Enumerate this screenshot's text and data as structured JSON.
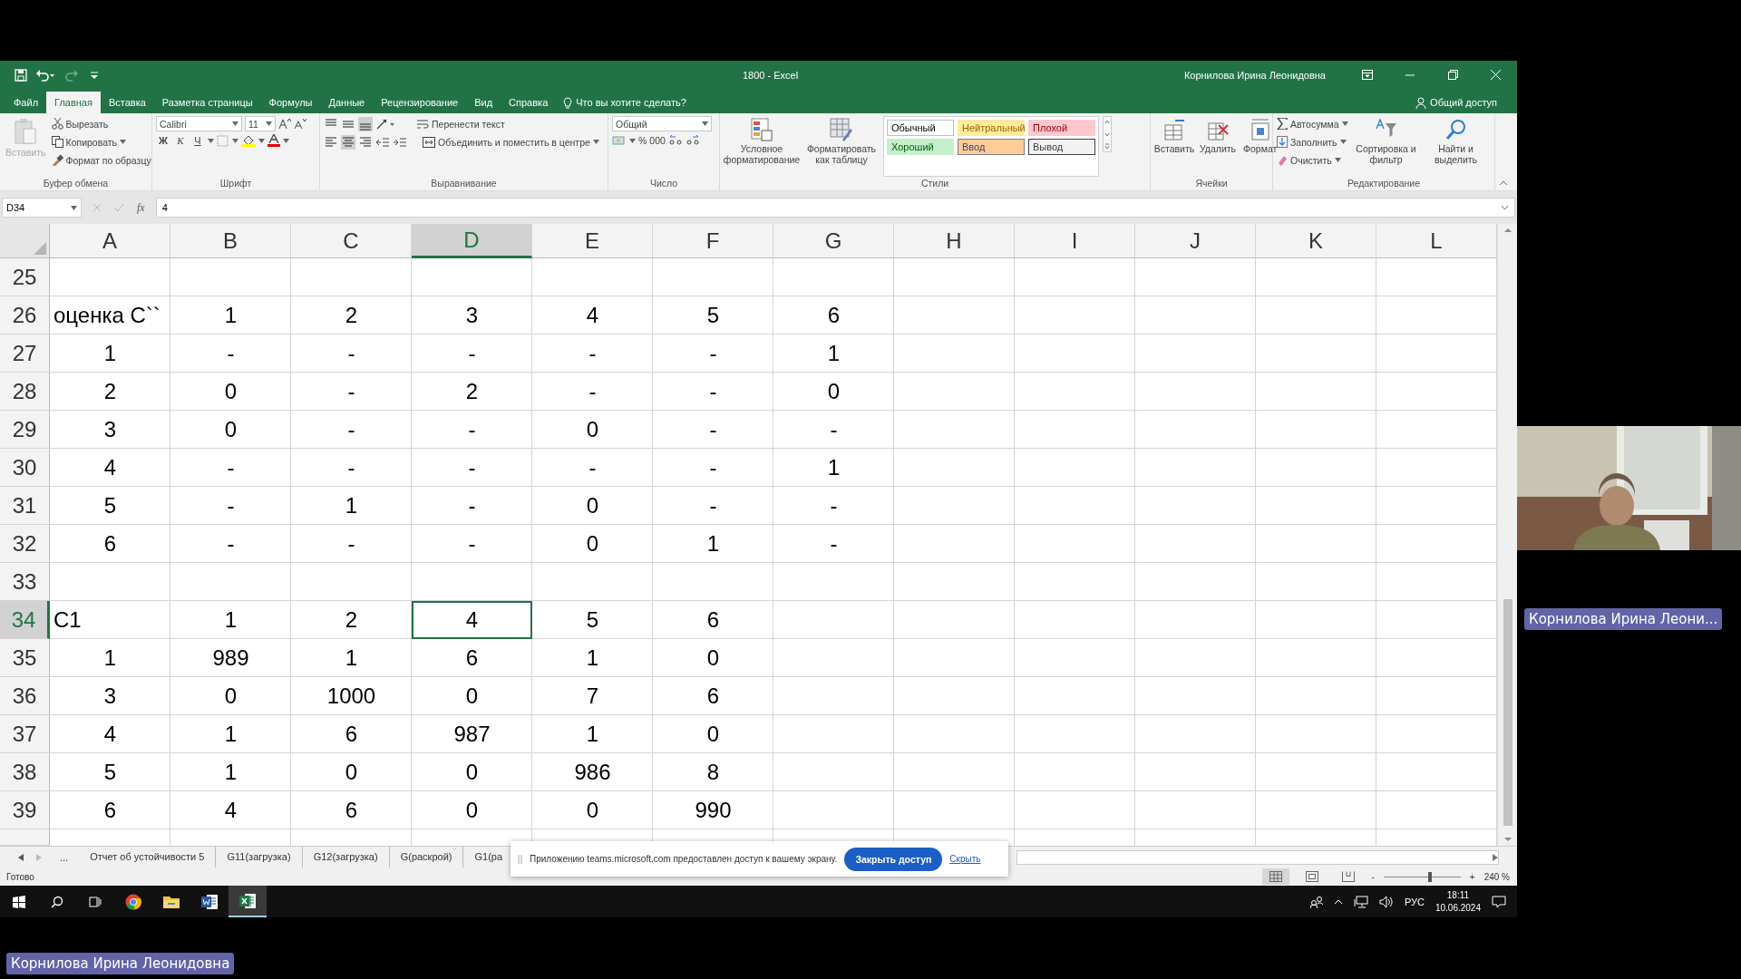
{
  "window": {
    "title": "1800  -  Excel",
    "user": "Корнилова Ирина Леонидовна"
  },
  "ribbon_tabs": [
    {
      "label": "Файл",
      "selected": false
    },
    {
      "label": "Главная",
      "selected": true
    },
    {
      "label": "Вставка",
      "selected": false
    },
    {
      "label": "Разметка страницы",
      "selected": false
    },
    {
      "label": "Формулы",
      "selected": false
    },
    {
      "label": "Данные",
      "selected": false
    },
    {
      "label": "Рецензирование",
      "selected": false
    },
    {
      "label": "Вид",
      "selected": false
    },
    {
      "label": "Справка",
      "selected": false
    }
  ],
  "tell_me": "Что вы хотите сделать?",
  "share": "Общий доступ",
  "clipboard": {
    "paste": "Вставить",
    "cut": "Вырезать",
    "copy": "Копировать",
    "format_painter": "Формат по образцу",
    "label": "Буфер обмена"
  },
  "font": {
    "name": "Calibri",
    "size": "11",
    "bold": "Ж",
    "italic": "К",
    "underline": "Ч",
    "label": "Шрифт"
  },
  "alignment": {
    "wrap": "Перенести текст",
    "merge": "Объединить и поместить в центре",
    "label": "Выравнивание"
  },
  "number": {
    "format": "Общий",
    "percent": "%",
    "thousands": "000",
    "label": "Число"
  },
  "styles": {
    "conditional": "Условное форматирование",
    "as_table": "Форматировать как таблицу",
    "label": "Стили",
    "cell_styles": [
      {
        "name": "Обычный",
        "kind": "normal"
      },
      {
        "name": "Нейтральный",
        "kind": "neutral"
      },
      {
        "name": "Плохой",
        "kind": "bad"
      },
      {
        "name": "Хороший",
        "kind": "good"
      },
      {
        "name": "Ввод",
        "kind": "input"
      },
      {
        "name": "Вывод",
        "kind": "output"
      }
    ]
  },
  "cells_group": {
    "insert": "Вставить",
    "delete": "Удалить",
    "format": "Формат",
    "label": "Ячейки"
  },
  "editing": {
    "autosum": "Автосумма",
    "fill": "Заполнить",
    "clear": "Очистить",
    "sort": "Сортировка и фильтр",
    "find": "Найти и выделить",
    "label": "Редактирование"
  },
  "formula_bar": {
    "name_box": "D34",
    "fx": "fx",
    "value": "4"
  },
  "sheet": {
    "columns": [
      {
        "label": "A",
        "selected": false
      },
      {
        "label": "B",
        "selected": false
      },
      {
        "label": "C",
        "selected": false
      },
      {
        "label": "D",
        "selected": true
      },
      {
        "label": "E",
        "selected": false
      },
      {
        "label": "F",
        "selected": false
      },
      {
        "label": "G",
        "selected": false
      },
      {
        "label": "H",
        "selected": false
      },
      {
        "label": "I",
        "selected": false
      },
      {
        "label": "J",
        "selected": false
      },
      {
        "label": "K",
        "selected": false
      },
      {
        "label": "L",
        "selected": false
      }
    ],
    "rows": [
      {
        "number": "25",
        "selected": false
      },
      {
        "number": "26",
        "selected": false,
        "first_cell_left": true,
        "cells": [
          "оценка C``",
          "1",
          "2",
          "3",
          "4",
          "5",
          "6"
        ]
      },
      {
        "number": "27",
        "selected": false,
        "cells": [
          "1",
          "-",
          "-",
          "-",
          "-",
          "-",
          "1"
        ]
      },
      {
        "number": "28",
        "selected": false,
        "cells": [
          "2",
          "0",
          "-",
          "2",
          "-",
          "-",
          "0"
        ]
      },
      {
        "number": "29",
        "selected": false,
        "cells": [
          "3",
          "0",
          "-",
          "-",
          "0",
          "-",
          "-"
        ]
      },
      {
        "number": "30",
        "selected": false,
        "cells": [
          "4",
          "-",
          "-",
          "-",
          "-",
          "-",
          "1"
        ]
      },
      {
        "number": "31",
        "selected": false,
        "cells": [
          "5",
          "-",
          "1",
          "-",
          "0",
          "-",
          "-"
        ]
      },
      {
        "number": "32",
        "selected": false,
        "cells": [
          "6",
          "-",
          "-",
          "-",
          "0",
          "1",
          "-"
        ]
      },
      {
        "number": "33",
        "selected": false
      },
      {
        "number": "34",
        "selected": true,
        "first_cell_left": true,
        "cells": [
          "C1",
          "1",
          "2",
          "4",
          "5",
          "6"
        ]
      },
      {
        "number": "35",
        "selected": false,
        "cells": [
          "1",
          "989",
          "1",
          "6",
          "1",
          "0"
        ]
      },
      {
        "number": "36",
        "selected": false,
        "cells": [
          "3",
          "0",
          "1000",
          "0",
          "7",
          "6"
        ]
      },
      {
        "number": "37",
        "selected": false,
        "cells": [
          "4",
          "1",
          "6",
          "987",
          "1",
          "0"
        ]
      },
      {
        "number": "38",
        "selected": false,
        "cells": [
          "5",
          "1",
          "0",
          "0",
          "986",
          "8"
        ]
      },
      {
        "number": "39",
        "selected": false,
        "cells": [
          "6",
          "4",
          "6",
          "0",
          "0",
          "990"
        ]
      }
    ]
  },
  "sheet_tabs": {
    "more": "...",
    "tabs": [
      "Отчет об устойчивости 5",
      "G11(загрузка)",
      "G12(загрузка)",
      "G(раскрой)",
      "G1(ра"
    ]
  },
  "status_bar": {
    "text": "Готово",
    "minus": "-",
    "plus": "+",
    "zoom": "240 %",
    "zoom_slider": {
      "level": 0.6
    }
  },
  "share_notice": {
    "message": "Приложению teams.microsoft.com предоставлен доступ к вашему экрану.",
    "stop": "Закрыть доступ",
    "hide": "Скрыть"
  },
  "taskbar": {
    "language": "РУС",
    "time": "18:11",
    "date": "10.06.2024"
  },
  "video": {
    "kind": "picture",
    "name": "Корнилова Ирина Леони..."
  },
  "presenter_label": "Корнилова Ирина Леонидовна"
}
